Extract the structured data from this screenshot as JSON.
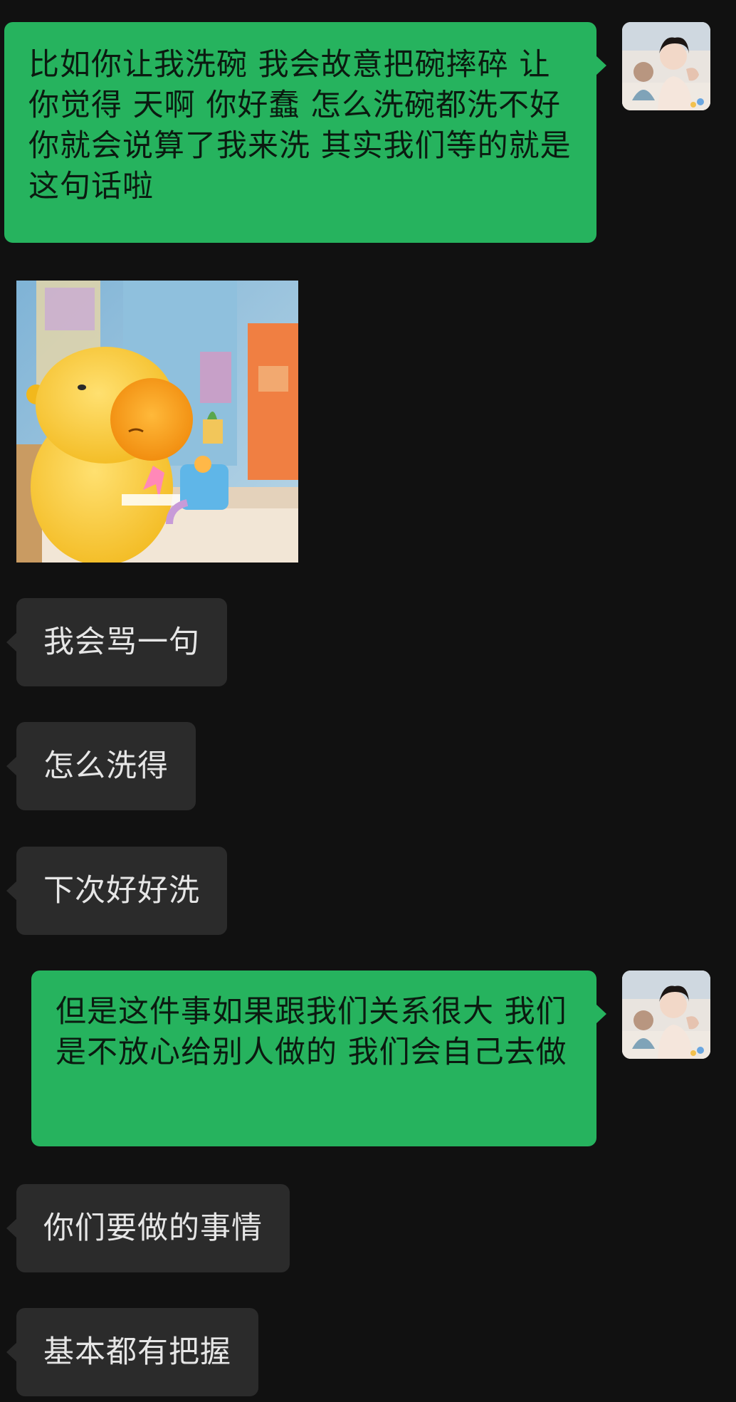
{
  "messages": [
    {
      "side": "out",
      "type": "text",
      "text": "比如你让我洗碗 我会故意把碗摔碎 让你觉得 天啊 你好蠢 怎么洗碗都洗不好 你就会说算了我来洗 其实我们等的就是这句话啦"
    },
    {
      "side": "in",
      "type": "sticker",
      "sticker_name": "yellow-capybara-at-desk"
    },
    {
      "side": "in",
      "type": "text",
      "text": "我会骂一句"
    },
    {
      "side": "in",
      "type": "text",
      "text": "怎么洗得"
    },
    {
      "side": "in",
      "type": "text",
      "text": "下次好好洗"
    },
    {
      "side": "out",
      "type": "text",
      "text": "但是这件事如果跟我们关系很大 我们是不放心给别人做的 我们会自己去做"
    },
    {
      "side": "in",
      "type": "text",
      "text": "你们要做的事情"
    },
    {
      "side": "in",
      "type": "text",
      "text": "基本都有把握"
    }
  ],
  "colors": {
    "background": "#111111",
    "outgoing_bubble": "#26b35e",
    "incoming_bubble": "#2b2b2b",
    "incoming_text": "#e6e6e6",
    "outgoing_text": "#0b1a10"
  }
}
